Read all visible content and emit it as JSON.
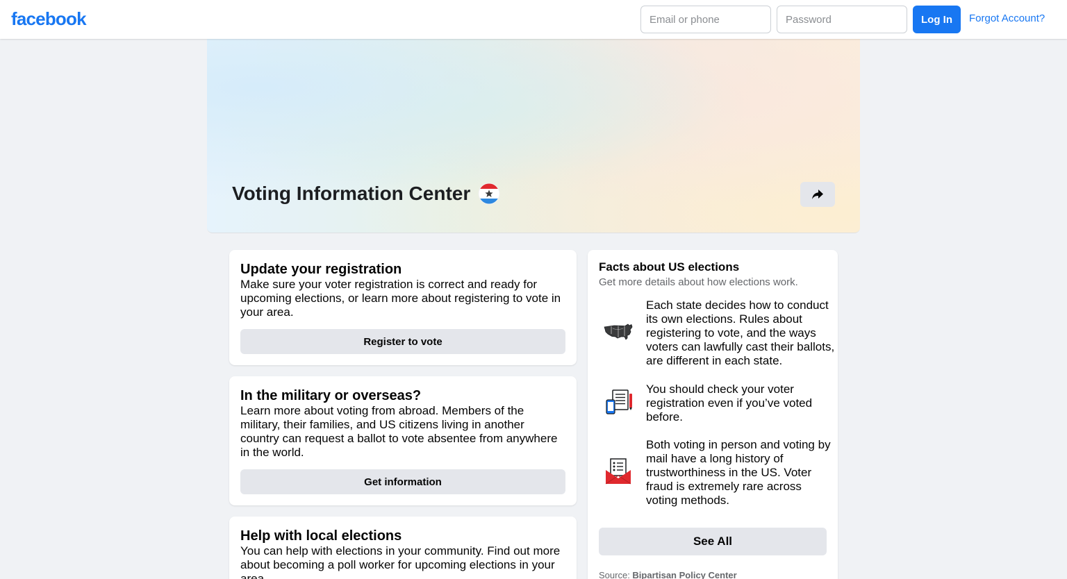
{
  "header": {
    "logo": "facebook",
    "email_placeholder": "Email or phone",
    "password_placeholder": "Password",
    "login_label": "Log In",
    "forgot_label": "Forgot Account?"
  },
  "cover": {
    "title": "Voting Information Center",
    "badge_icon": "vote-star-badge-icon",
    "share_icon": "share-arrow-icon"
  },
  "cards": [
    {
      "title": "Update your registration",
      "description": "Make sure your voter registration is correct and ready for upcoming elections, or learn more about registering to vote in your area.",
      "button": "Register to vote"
    },
    {
      "title": "In the military or overseas?",
      "description": "Learn more about voting from abroad. Members of the military, their families, and US citizens living in another country can request a ballot to vote absentee from anywhere in the world.",
      "button": "Get information"
    },
    {
      "title": "Help with local elections",
      "description": "You can help with elections in your community. Find out more about becoming a poll worker for upcoming elections in your area."
    }
  ],
  "facts": {
    "title": "Facts about US elections",
    "subtitle": "Get more details about how elections work.",
    "items": [
      {
        "icon": "us-map-icon",
        "text": "Each state decides how to conduct its own elections. Rules about registering to vote, and the ways voters can lawfully cast their ballots, are different in each state."
      },
      {
        "icon": "phone-document-icon",
        "text": "You should check your voter registration even if you’ve voted before."
      },
      {
        "icon": "mail-ballot-icon",
        "text": "Both voting in person and voting by mail have a long history of trustworthiness in the US. Voter fraud is extremely rare across voting methods."
      }
    ],
    "see_all": "See All",
    "source_prefix": "Source: ",
    "source_name": "Bipartisan Policy Center"
  },
  "colors": {
    "brand": "#1877f2",
    "background": "#f0f2f5",
    "button_gray": "#e4e6eb"
  }
}
